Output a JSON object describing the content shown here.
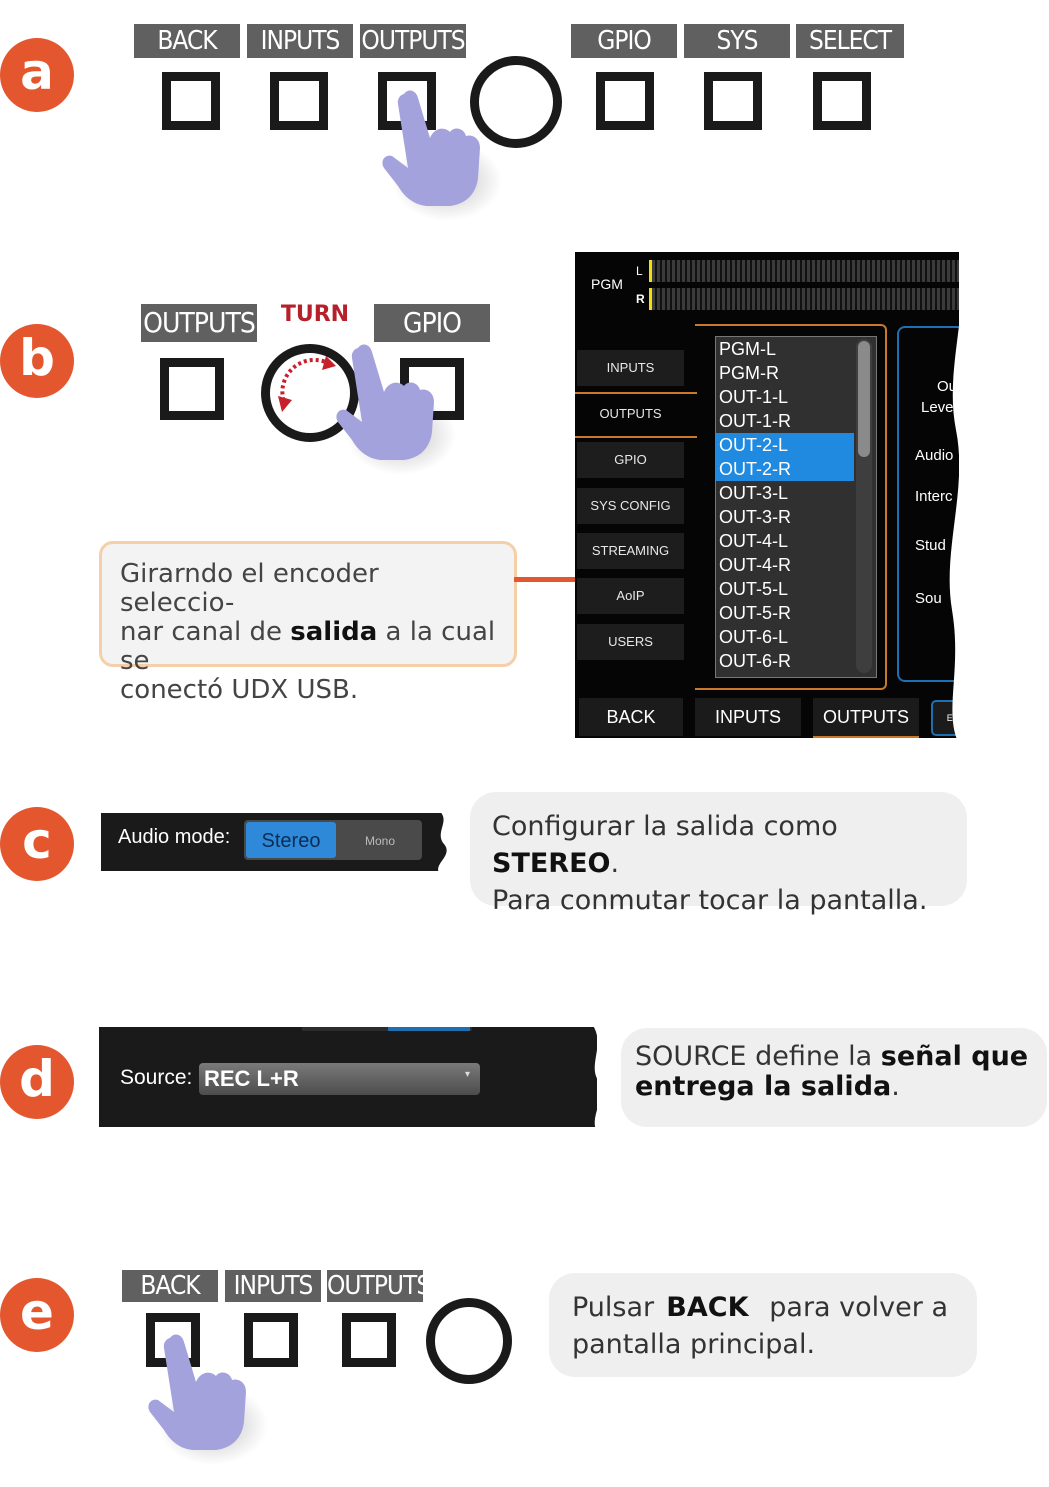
{
  "steps": {
    "a": "a",
    "b": "b",
    "c": "c",
    "d": "d",
    "e": "e"
  },
  "panel_a": {
    "keys": [
      "BACK",
      "INPUTS",
      "OUTPUTS",
      "GPIO",
      "SYS",
      "SELECT"
    ]
  },
  "panel_b": {
    "keys": [
      "OUTPUTS",
      "GPIO"
    ],
    "turn_label": "TURN",
    "callout": {
      "line1": "Girarndo el encoder seleccio-",
      "line2_pre": "nar canal  de ",
      "line2_bold": "salida",
      "line2_post": " a la cual se",
      "line3": "conectó UDX USB."
    },
    "screen": {
      "meter_label": "PGM",
      "meter_l": "L",
      "meter_r": "R",
      "menu": [
        "INPUTS",
        "OUTPUTS",
        "GPIO",
        "SYS CONFIG",
        "STREAMING",
        "AoIP",
        "USERS"
      ],
      "list": [
        "PGM-L",
        "PGM-R",
        "OUT-1-L",
        "OUT-1-R",
        "OUT-2-L",
        "OUT-2-R",
        "OUT-3-L",
        "OUT-3-R",
        "OUT-4-L",
        "OUT-4-R",
        "OUT-5-L",
        "OUT-5-R",
        "OUT-6-L",
        "OUT-6-R"
      ],
      "selected": [
        "OUT-2-L",
        "OUT-2-R"
      ],
      "side_labels": [
        "Ou",
        "Level",
        "Audio",
        "Interc",
        "Stud",
        "Sou"
      ],
      "bottom": [
        "BACK",
        "INPUTS",
        "OUTPUTS",
        "ED"
      ]
    }
  },
  "panel_c": {
    "label": "Audio mode:",
    "options": [
      "Stereo",
      "Mono"
    ],
    "selected": "Stereo",
    "callout_pre": "Configurar la salida como ",
    "callout_bold": "STEREO",
    "callout_post": ".",
    "callout_line2": "Para conmutar tocar la pantalla."
  },
  "panel_d": {
    "label": "Source:",
    "value": "REC L+R",
    "callout_pre": "SOURCE define la ",
    "callout_bold1": "señal que",
    "callout_bold2": "entrega la salida",
    "callout_post": "."
  },
  "panel_e": {
    "keys": [
      "BACK",
      "INPUTS",
      "OUTPUTS"
    ],
    "callout_pre": "Pulsar ",
    "callout_bold": "BACK",
    "callout_post": " para volver a",
    "callout_line2": "pantalla principal."
  },
  "colors": {
    "accent": "#e4572e",
    "selection": "#1f8ae0",
    "key_label": "#606060",
    "hand": "#a4a2dc",
    "callout_border": "#f5cfa8"
  }
}
